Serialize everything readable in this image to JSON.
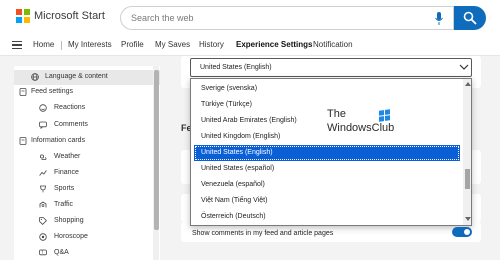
{
  "header": {
    "brand": "Microsoft Start",
    "search_placeholder": "Search the web",
    "logo_colors": [
      "#f25022",
      "#7fba00",
      "#00a4ef",
      "#ffb900"
    ],
    "accent": "#0f6cbd"
  },
  "nav": {
    "items": [
      "Home",
      "My Interests",
      "Profile",
      "My Saves",
      "History",
      "Experience Settings",
      "Notification"
    ],
    "active": "Experience Settings"
  },
  "sidebar": {
    "items": [
      {
        "label": "Language & content",
        "icon": "globe-icon",
        "selected": true
      },
      {
        "label": "Feed settings",
        "icon": "document-icon"
      },
      {
        "label": "Reactions",
        "icon": "smiley-icon"
      },
      {
        "label": "Comments",
        "icon": "comment-icon"
      },
      {
        "label": "Information cards",
        "icon": "document-icon"
      },
      {
        "label": "Weather",
        "icon": "weather-icon"
      },
      {
        "label": "Finance",
        "icon": "chart-icon"
      },
      {
        "label": "Sports",
        "icon": "sports-icon"
      },
      {
        "label": "Traffic",
        "icon": "traffic-icon"
      },
      {
        "label": "Shopping",
        "icon": "tag-icon"
      },
      {
        "label": "Horoscope",
        "icon": "horoscope-icon"
      },
      {
        "label": "Q&A",
        "icon": "qa-icon"
      }
    ]
  },
  "content": {
    "region_select_value": "United States (English)",
    "dropdown_options": [
      "Sverige (svenska)",
      "Türkiye (Türkçe)",
      "United Arab Emirates (English)",
      "United Kingdom (English)",
      "United States (English)",
      "United States (español)",
      "Venezuela (español)",
      "Việt Nam (Tiếng Việt)",
      "Österreich (Deutsch)"
    ],
    "selected_option": "United States (English)",
    "partial_heading": "Fe",
    "show_comments_label": "Show comments in my feed and article pages",
    "show_comments_on": true
  },
  "watermark": {
    "line1": "The",
    "line2": "WindowsClub"
  }
}
